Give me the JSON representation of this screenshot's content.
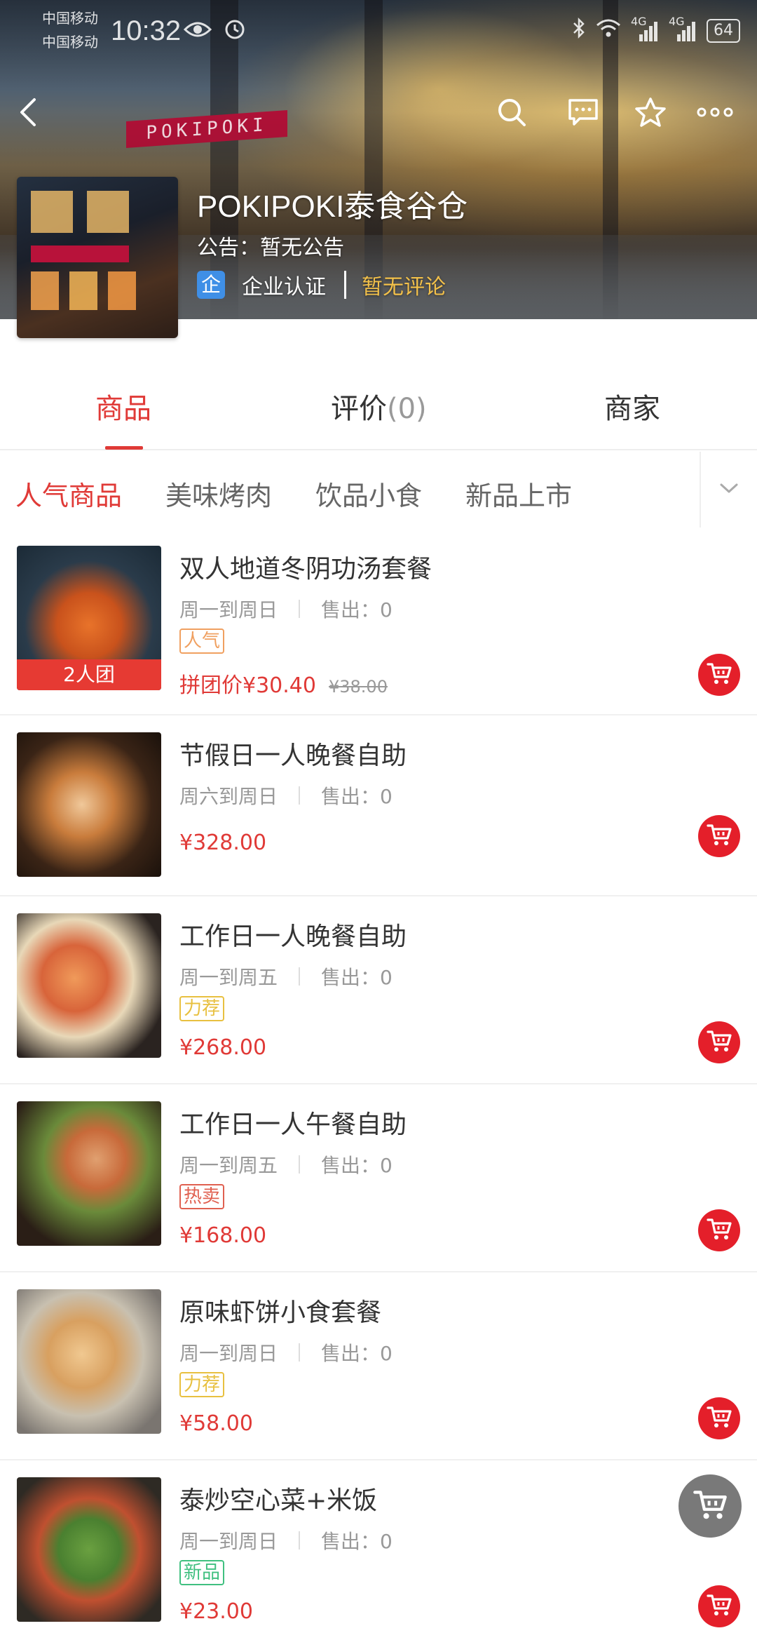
{
  "status_bar": {
    "carrier_1": "中国移动",
    "carrier_2": "中国移动",
    "time": "10:32",
    "network_1": "4G",
    "network_2": "4G",
    "battery": "64"
  },
  "header": {
    "back_icon": "back-arrow-icon",
    "actions": [
      "search-icon",
      "message-icon",
      "star-icon",
      "more-icon"
    ]
  },
  "store": {
    "name": "POKIPOKI泰食谷仓",
    "notice": "公告：暂无公告",
    "cert_badge": "企",
    "cert_label": "企业认证",
    "review_status": "暂无评论"
  },
  "tabs": {
    "goods": "商品",
    "reviews": "评价",
    "reviews_count": "(0)",
    "merchant": "商家"
  },
  "categories": [
    "人气商品",
    "美味烤肉",
    "饮品小食",
    "新品上市"
  ],
  "colors": {
    "accent": "#e03a37",
    "cart": "#e41f2a",
    "tag_popular": "#f0a060",
    "tag_recommend": "#e8c040",
    "tag_hot": "#e06050",
    "tag_new": "#40c080"
  },
  "products": [
    {
      "name": "双人地道冬阴功汤套餐",
      "days": "周一到周日",
      "sold": "售出：0",
      "tag": "人气",
      "group_label": "2人团",
      "price": "拼团价¥30.40",
      "original_price": "¥38.00"
    },
    {
      "name": "节假日一人晚餐自助",
      "days": "周六到周日",
      "sold": "售出：0",
      "price": "¥328.00"
    },
    {
      "name": "工作日一人晚餐自助",
      "days": "周一到周五",
      "sold": "售出：0",
      "tag": "力荐",
      "price": "¥268.00"
    },
    {
      "name": "工作日一人午餐自助",
      "days": "周一到周五",
      "sold": "售出：0",
      "tag": "热卖",
      "price": "¥168.00"
    },
    {
      "name": "原味虾饼小食套餐",
      "days": "周一到周日",
      "sold": "售出：0",
      "tag": "力荐",
      "price": "¥58.00"
    },
    {
      "name": "泰炒空心菜+米饭",
      "days": "周一到周日",
      "sold": "售出：0",
      "tag": "新品",
      "price": "¥23.00"
    }
  ]
}
